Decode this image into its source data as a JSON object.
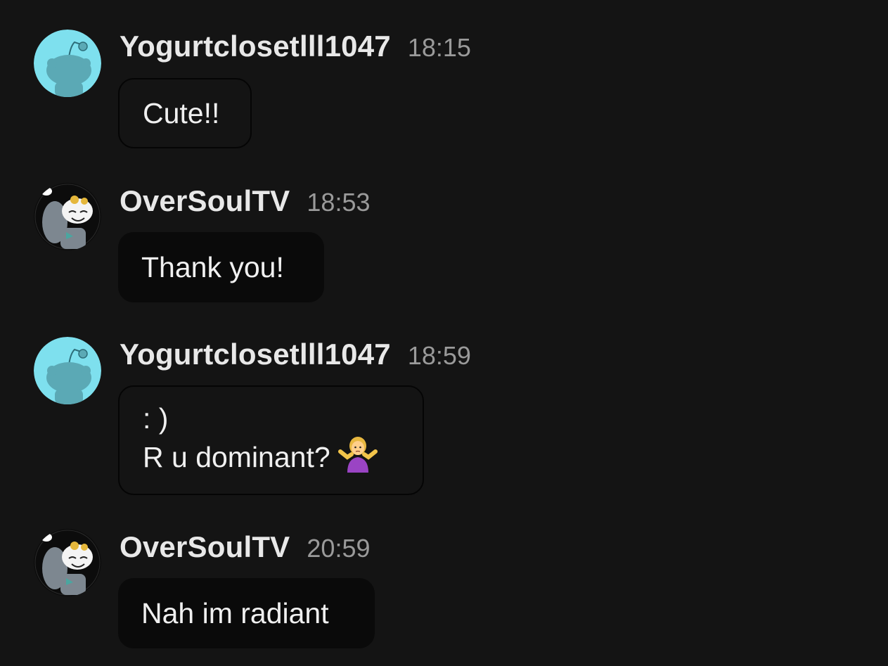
{
  "messages": [
    {
      "username": "Yogurtclosetlll1047",
      "time": "18:15",
      "avatar_icon": "snoo-teal-avatar-icon",
      "lines": [
        "Cute!!"
      ]
    },
    {
      "username": "OverSoulTV",
      "time": "18:53",
      "avatar_icon": "snoo-gray-hood-avatar-icon",
      "lines": [
        "Thank you!"
      ]
    },
    {
      "username": "Yogurtclosetlll1047",
      "time": "18:59",
      "avatar_icon": "snoo-teal-avatar-icon",
      "lines": [
        ": )",
        "R u dominant?"
      ],
      "emoji_icon": "person-shrugging-emoji-icon"
    },
    {
      "username": "OverSoulTV",
      "time": "20:59",
      "avatar_icon": "snoo-gray-hood-avatar-icon",
      "lines": [
        "Nah im radiant"
      ]
    }
  ],
  "colors": {
    "background": "#141414",
    "teal_avatar": "#7ee0ee",
    "username": "#e8e8e8",
    "timestamp": "#9a9a9a"
  }
}
